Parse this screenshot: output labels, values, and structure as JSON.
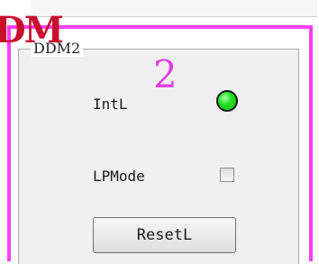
{
  "brand_fragment": "DM",
  "group": {
    "title": "DDM2"
  },
  "annotation_number": "2",
  "intl": {
    "label": "IntL",
    "state": "on",
    "color": "#22e022"
  },
  "lpmode": {
    "label": "LPMode",
    "checked": false
  },
  "reset_button": {
    "label": "ResetL"
  },
  "colors": {
    "frame": "#ff3fff",
    "number": "#e23ee2",
    "brand": "#c8102e"
  }
}
